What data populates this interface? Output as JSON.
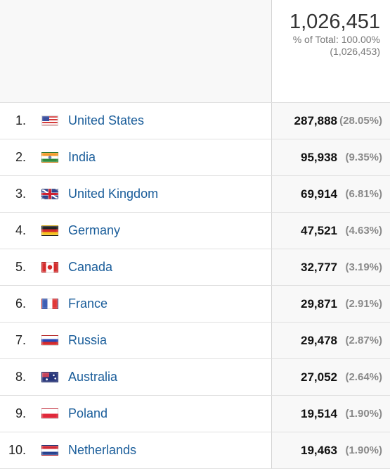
{
  "header": {
    "total": "1,026,451",
    "pct_of_total": "% of Total: 100.00%",
    "grand_total": "(1,026,453)"
  },
  "rows": [
    {
      "rank": "1.",
      "country": "United States",
      "flag": "us-flag-icon",
      "value": "287,888",
      "pct": "(28.05%)"
    },
    {
      "rank": "2.",
      "country": "India",
      "flag": "in-flag-icon",
      "value": "95,938",
      "pct": "(9.35%)"
    },
    {
      "rank": "3.",
      "country": "United Kingdom",
      "flag": "gb-flag-icon",
      "value": "69,914",
      "pct": "(6.81%)"
    },
    {
      "rank": "4.",
      "country": "Germany",
      "flag": "de-flag-icon",
      "value": "47,521",
      "pct": "(4.63%)"
    },
    {
      "rank": "5.",
      "country": "Canada",
      "flag": "ca-flag-icon",
      "value": "32,777",
      "pct": "(3.19%)"
    },
    {
      "rank": "6.",
      "country": "France",
      "flag": "fr-flag-icon",
      "value": "29,871",
      "pct": "(2.91%)"
    },
    {
      "rank": "7.",
      "country": "Russia",
      "flag": "ru-flag-icon",
      "value": "29,478",
      "pct": "(2.87%)"
    },
    {
      "rank": "8.",
      "country": "Australia",
      "flag": "au-flag-icon",
      "value": "27,052",
      "pct": "(2.64%)"
    },
    {
      "rank": "9.",
      "country": "Poland",
      "flag": "pl-flag-icon",
      "value": "19,514",
      "pct": "(1.90%)"
    },
    {
      "rank": "10.",
      "country": "Netherlands",
      "flag": "nl-flag-icon",
      "value": "19,463",
      "pct": "(1.90%)"
    }
  ],
  "colors": {
    "link": "#1a5d9a",
    "value": "#111111",
    "pct": "#8a8a8a"
  }
}
